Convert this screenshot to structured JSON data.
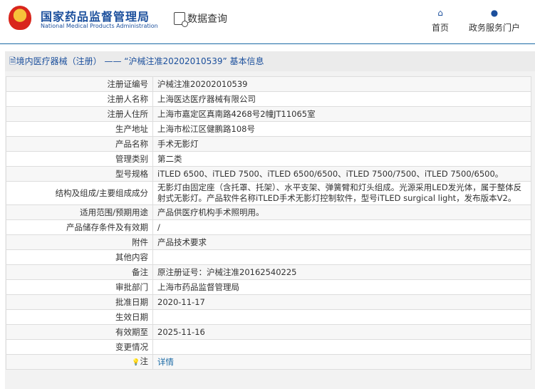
{
  "header": {
    "title": "国家药品监督管理局",
    "subtitle": "National Medical Products Administration",
    "data_query": "数据查询",
    "nav": [
      {
        "label": "首页",
        "icon": "home-icon"
      },
      {
        "label": "政务服务门户",
        "icon": "user-icon"
      }
    ]
  },
  "panel": {
    "title": "境内医疗器械（注册） —— “沪械注准20202010539” 基本信息"
  },
  "rows": [
    {
      "label": "注册证编号",
      "value": "沪械注准20202010539"
    },
    {
      "label": "注册人名称",
      "value": "上海医达医疗器械有限公司"
    },
    {
      "label": "注册人住所",
      "value": "上海市嘉定区真南路4268号2幢JT11065室"
    },
    {
      "label": "生产地址",
      "value": "上海市松江区健鹏路108号"
    },
    {
      "label": "产品名称",
      "value": "手术无影灯"
    },
    {
      "label": "管理类别",
      "value": "第二类"
    },
    {
      "label": "型号规格",
      "value": "iTLED 6500、iTLED 7500、iTLED 6500/6500、iTLED 7500/7500、iTLED 7500/6500。"
    },
    {
      "label": "结构及组成/主要组成成分",
      "value": "无影灯由固定座（含托罩、托架）、水平支架、弹簧臂和灯头组成。光源采用LED发光体，属于整体反射式无影灯。产品软件名称iTLED手术无影灯控制软件，型号iTLED surgical light，发布版本V2。"
    },
    {
      "label": "适用范围/预期用途",
      "value": "产品供医疗机构手术照明用。"
    },
    {
      "label": "产品储存条件及有效期",
      "value": "/"
    },
    {
      "label": "附件",
      "value": "产品技术要求"
    },
    {
      "label": "其他内容",
      "value": ""
    },
    {
      "label": "备注",
      "value": "原注册证号：沪械注准20162540225"
    },
    {
      "label": "审批部门",
      "value": "上海市药品监督管理局"
    },
    {
      "label": "批准日期",
      "value": "2020-11-17"
    },
    {
      "label": "生效日期",
      "value": ""
    },
    {
      "label": "有效期至",
      "value": "2025-11-16"
    },
    {
      "label": "变更情况",
      "value": ""
    },
    {
      "label": "注",
      "value": "详情"
    }
  ]
}
